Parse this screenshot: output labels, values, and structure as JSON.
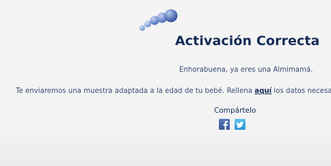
{
  "colors": {
    "background": "#f3f3f3",
    "title": "#152c55",
    "text": "#3b4a73",
    "logo_blue": "#3d5fa8",
    "facebook": "#3b5998",
    "twitter": "#2d8fd0"
  },
  "logo": {
    "icon": "bubbles-logo-icon"
  },
  "page": {
    "title": "Activación Correcta",
    "message_line1": "Enhorabuena, ya eres una Almimamá.",
    "message_line2_before": "Te enviaremos una muestra adaptada a la edad de tu bebé. Rellena ",
    "message_line2_link": "aquí",
    "message_line2_after": " los datos necesarios"
  },
  "share": {
    "label": "Compártelo",
    "facebook_icon": "facebook-icon",
    "twitter_icon": "twitter-icon"
  }
}
